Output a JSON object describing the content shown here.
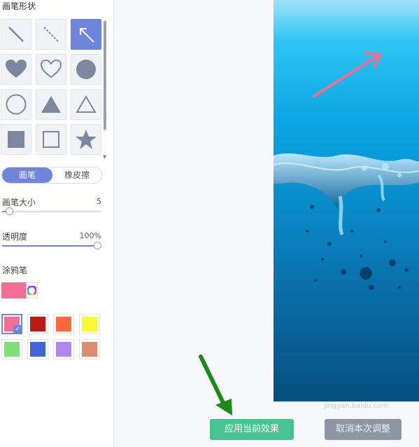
{
  "brush_panel": {
    "title": "画笔形状",
    "shapes": [
      "line",
      "dashed-line",
      "arrow",
      "heart-filled",
      "heart-outline",
      "circle-filled",
      "circle-outline",
      "triangle-filled",
      "triangle-outline",
      "square-filled",
      "square-outline",
      "star-filled"
    ],
    "selected_shape": "arrow"
  },
  "mode": {
    "pen": "画笔",
    "eraser": "橡皮擦",
    "active": "pen"
  },
  "brush_size": {
    "label": "画笔大小",
    "value": "5",
    "fraction": 0.05
  },
  "opacity": {
    "label": "透明度",
    "value": "100%",
    "fraction": 1.0
  },
  "doodle": {
    "label": "涂鸦笔",
    "current_color": "#f46e95",
    "swatches": [
      "#f46e95",
      "#b91c14",
      "#ff6a3d",
      "#f9f935",
      "#7ddf7a",
      "#4263d6",
      "#b184ee",
      "#d98c6e"
    ],
    "selected_index": 0
  },
  "actions": {
    "apply": "应用当前效果",
    "cancel": "取消本次调整"
  },
  "watermark": "jingyan.baidu.com"
}
